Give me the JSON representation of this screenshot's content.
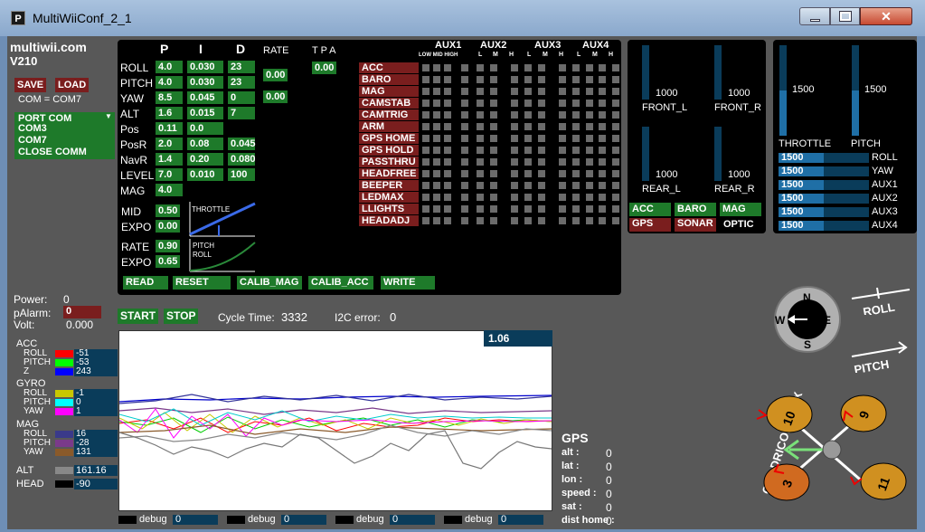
{
  "window": {
    "title": "MultiWiiConf_2_1"
  },
  "app": {
    "name": "multiwii.com",
    "version": "V210"
  },
  "buttons": {
    "save": "SAVE",
    "load": "LOAD",
    "read": "READ",
    "reset": "RESET",
    "calib_mag": "CALIB_MAG",
    "calib_acc": "CALIB_ACC",
    "write": "WRITE",
    "start": "START",
    "stop": "STOP"
  },
  "com": {
    "status": "COM = COM7",
    "port_label": "PORT COM",
    "options": [
      "COM3",
      "COM7",
      "CLOSE COMM"
    ]
  },
  "pid": {
    "headers": {
      "p": "P",
      "i": "I",
      "d": "D",
      "rate": "RATE",
      "tpa": "T P A"
    },
    "rows": [
      {
        "name": "ROLL",
        "p": "4.0",
        "i": "0.030",
        "d": "23"
      },
      {
        "name": "PITCH",
        "p": "4.0",
        "i": "0.030",
        "d": "23"
      },
      {
        "name": "YAW",
        "p": "8.5",
        "i": "0.045",
        "d": "0"
      },
      {
        "name": "ALT",
        "p": "1.6",
        "i": "0.015",
        "d": "7"
      },
      {
        "name": "Pos",
        "p": "0.11",
        "i": "0.0",
        "d": ""
      },
      {
        "name": "PosR",
        "p": "2.0",
        "i": "0.08",
        "d": "0.045"
      },
      {
        "name": "NavR",
        "p": "1.4",
        "i": "0.20",
        "d": "0.080"
      },
      {
        "name": "LEVEL",
        "p": "7.0",
        "i": "0.010",
        "d": "100"
      },
      {
        "name": "MAG",
        "p": "4.0",
        "i": "",
        "d": ""
      }
    ],
    "rate_rollpitch": "0.00",
    "rate_yaw": "0.00",
    "tpa": "0.00",
    "mid_label": "MID",
    "mid": "0.50",
    "expo_label": "EXPO",
    "expo": "0.00",
    "rate_label": "RATE",
    "rate": "0.90",
    "expo2_label": "EXPO",
    "expo2": "0.65",
    "throttle_curve_label": "THROTTLE",
    "pitch_curve_label": "PITCH",
    "roll_curve_label": "ROLL"
  },
  "aux": {
    "headers": [
      "AUX1",
      "AUX2",
      "AUX3",
      "AUX4"
    ],
    "aux1_sub": "LOW MID HIGH",
    "sub": [
      "L",
      "M",
      "H"
    ],
    "boxes": [
      "ACC",
      "BARO",
      "MAG",
      "CAMSTAB",
      "CAMTRIG",
      "ARM",
      "GPS HOME",
      "GPS HOLD",
      "PASSTHRU",
      "HEADFREE",
      "BEEPER",
      "LEDMAX",
      "LLIGHTS",
      "HEADADJ"
    ]
  },
  "motors": [
    {
      "label": "FRONT_L",
      "value": "1000"
    },
    {
      "label": "FRONT_R",
      "value": "1000"
    },
    {
      "label": "REAR_L",
      "value": "1000"
    },
    {
      "label": "REAR_R",
      "value": "1000"
    }
  ],
  "rc": {
    "throttle": {
      "label": "THROTTLE",
      "value": "1500"
    },
    "pitch": {
      "label": "PITCH",
      "value": "1500"
    },
    "channels": [
      {
        "label": "ROLL",
        "value": "1500"
      },
      {
        "label": "YAW",
        "value": "1500"
      },
      {
        "label": "AUX1",
        "value": "1500"
      },
      {
        "label": "AUX2",
        "value": "1500"
      },
      {
        "label": "AUX3",
        "value": "1500"
      },
      {
        "label": "AUX4",
        "value": "1500"
      }
    ]
  },
  "sensors": {
    "acc": "ACC",
    "baro": "BARO",
    "mag": "MAG",
    "gps": "GPS",
    "sonar": "SONAR",
    "optic": "OPTIC"
  },
  "status": {
    "power_label": "Power:",
    "power": "0",
    "palarm_label": "pAlarm:",
    "palarm": "0",
    "volt_label": "Volt:",
    "volt": "0.000",
    "cycle_label": "Cycle Time:",
    "cycle": "3332",
    "i2c_label": "I2C error:",
    "i2c": "0"
  },
  "graph": {
    "scale": "1.06"
  },
  "legend": {
    "acc": "ACC",
    "gyro": "GYRO",
    "mag": "MAG",
    "alt": "ALT",
    "head": "HEAD",
    "acc_items": [
      {
        "name": "ROLL",
        "value": "-51",
        "color": "#ff0000"
      },
      {
        "name": "PITCH",
        "value": "-53",
        "color": "#00ff00"
      },
      {
        "name": "Z",
        "value": "243",
        "color": "#0000ff"
      }
    ],
    "gyro_items": [
      {
        "name": "ROLL",
        "value": "-1",
        "color": "#c8c800"
      },
      {
        "name": "PITCH",
        "value": "0",
        "color": "#00ffff"
      },
      {
        "name": "YAW",
        "value": "1",
        "color": "#ff00ff"
      }
    ],
    "mag_items": [
      {
        "name": "ROLL",
        "value": "16",
        "color": "#3a3a8a"
      },
      {
        "name": "PITCH",
        "value": "-28",
        "color": "#7a3a8a"
      },
      {
        "name": "YAW",
        "value": "131",
        "color": "#8a5a2a"
      }
    ],
    "alt_value": "161.16",
    "head_value": "-90"
  },
  "gps": {
    "title": "GPS",
    "fields": [
      {
        "label": "alt :",
        "value": "0"
      },
      {
        "label": "lat :",
        "value": "0"
      },
      {
        "label": "lon :",
        "value": "0"
      },
      {
        "label": "speed :",
        "value": "0"
      },
      {
        "label": "sat :",
        "value": "0"
      },
      {
        "label": "dist home :",
        "value": "0"
      }
    ]
  },
  "debug": [
    {
      "label": "debug",
      "value": "0"
    },
    {
      "label": "debug",
      "value": "0"
    },
    {
      "label": "debug",
      "value": "0"
    },
    {
      "label": "debug",
      "value": "0"
    }
  ],
  "compass": {
    "n": "N",
    "s": "S",
    "e": "E",
    "w": "W"
  },
  "attitude": {
    "roll": "ROLL",
    "pitch": "PITCH"
  },
  "quad": {
    "label": "QUADRICOPTER X",
    "motors": [
      "10",
      "9",
      "3",
      "11"
    ]
  }
}
